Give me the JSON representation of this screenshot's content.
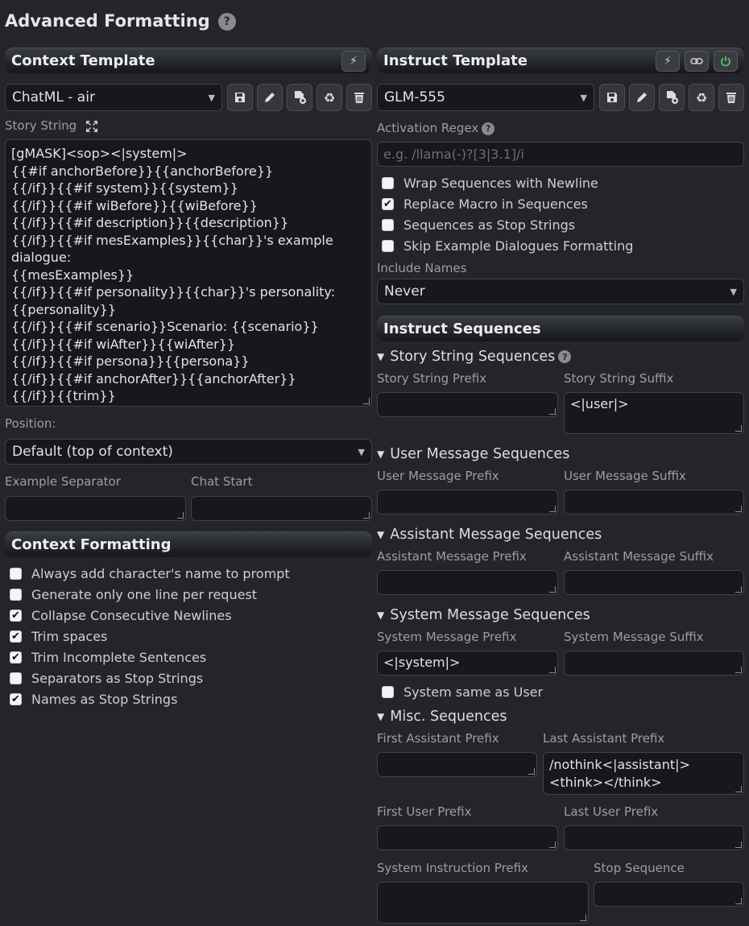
{
  "page": {
    "title": "Advanced Formatting"
  },
  "context": {
    "header": "Context Template",
    "preset": "ChatML - air",
    "story_string_label": "Story String",
    "story_string": "[gMASK]<sop><|system|>\n{{#if anchorBefore}}{{anchorBefore}}\n{{/if}}{{#if system}}{{system}}\n{{/if}}{{#if wiBefore}}{{wiBefore}}\n{{/if}}{{#if description}}{{description}}\n{{/if}}{{#if mesExamples}}{{char}}'s example\ndialogue:\n{{mesExamples}}\n{{/if}}{{#if personality}}{{char}}'s personality:\n{{personality}}\n{{/if}}{{#if scenario}}Scenario: {{scenario}}\n{{/if}}{{#if wiAfter}}{{wiAfter}}\n{{/if}}{{#if persona}}{{persona}}\n{{/if}}{{#if anchorAfter}}{{anchorAfter}}\n{{/if}}{{trim}}",
    "position_label": "Position:",
    "position_value": "Default (top of context)",
    "example_separator_label": "Example Separator",
    "chat_start_label": "Chat Start"
  },
  "context_formatting": {
    "header": "Context Formatting",
    "options": [
      {
        "label": "Always add character's name to prompt",
        "checked": false
      },
      {
        "label": "Generate only one line per request",
        "checked": false
      },
      {
        "label": "Collapse Consecutive Newlines",
        "checked": true
      },
      {
        "label": "Trim spaces",
        "checked": true
      },
      {
        "label": "Trim Incomplete Sentences",
        "checked": true
      },
      {
        "label": "Separators as Stop Strings",
        "checked": false
      },
      {
        "label": "Names as Stop Strings",
        "checked": true
      }
    ]
  },
  "instruct": {
    "header": "Instruct Template",
    "preset": "GLM-555",
    "activation_regex_label": "Activation Regex",
    "activation_regex_placeholder": "e.g. /llama(-)?[3|3.1]/i",
    "options": [
      {
        "label": "Wrap Sequences with Newline",
        "checked": false
      },
      {
        "label": "Replace Macro in Sequences",
        "checked": true
      },
      {
        "label": "Sequences as Stop Strings",
        "checked": false
      },
      {
        "label": "Skip Example Dialogues Formatting",
        "checked": false
      }
    ],
    "include_names_label": "Include Names",
    "include_names_value": "Never"
  },
  "sequences": {
    "header": "Instruct Sequences",
    "story_string_title": "Story String Sequences",
    "story_string_prefix_label": "Story String Prefix",
    "story_string_suffix_label": "Story String Suffix",
    "story_string_suffix_value": "<|user|>",
    "user_title": "User Message Sequences",
    "user_prefix_label": "User Message Prefix",
    "user_suffix_label": "User Message Suffix",
    "assistant_title": "Assistant Message Sequences",
    "assistant_prefix_label": "Assistant Message Prefix",
    "assistant_suffix_label": "Assistant Message Suffix",
    "system_title": "System Message Sequences",
    "system_prefix_label": "System Message Prefix",
    "system_prefix_value": "<|system|>",
    "system_suffix_label": "System Message Suffix",
    "system_same_label": "System same as User",
    "misc_title": "Misc. Sequences",
    "first_assistant_label": "First Assistant Prefix",
    "last_assistant_label": "Last Assistant Prefix",
    "last_assistant_value": "/nothink<|assistant|>\n<think></think>",
    "first_user_label": "First User Prefix",
    "last_user_label": "Last User Prefix",
    "system_instruction_label": "System Instruction Prefix",
    "stop_sequence_label": "Stop Sequence"
  }
}
